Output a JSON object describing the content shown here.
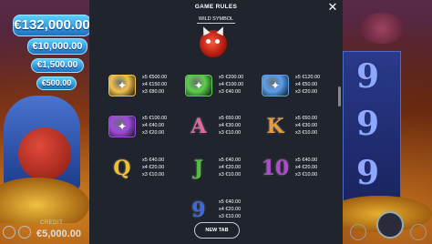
{
  "game": {
    "jackpots": [
      "€132,000.00",
      "€10,000.00",
      "€1,500.00",
      "€500.00"
    ],
    "credit_label": "CREDIT",
    "credit_value": "€5,000.00"
  },
  "reel_symbols": [
    "9",
    "9",
    "9"
  ],
  "panel": {
    "title": "GAME RULES",
    "close": "✕",
    "section": "WILD SYMBOL",
    "button": "NEW TAB"
  },
  "symbols": [
    {
      "icon": "gold-gem-icon",
      "color": "#f4c04a",
      "pays": [
        "x5  €500.00",
        "x4  €150.00",
        "x3  €80.00"
      ]
    },
    {
      "icon": "green-gem-icon",
      "color": "#5ad04a",
      "pays": [
        "x5  €200.00",
        "x4  €100.00",
        "x3  €40.00"
      ]
    },
    {
      "icon": "blue-gem-icon",
      "color": "#5aa0f0",
      "pays": [
        "x5  €120.00",
        "x4  €50.00",
        "x3  €20.00"
      ]
    },
    {
      "icon": "purple-gem-icon",
      "color": "#a04ae0",
      "pays": [
        "x5  €100.00",
        "x4  €40.00",
        "x3  €20.00"
      ]
    },
    {
      "letter": "A",
      "color": "#e06aa0",
      "pays": [
        "x5  €60.00",
        "x4  €30.00",
        "x3  €10.00"
      ]
    },
    {
      "letter": "K",
      "color": "#e89a40",
      "pays": [
        "x5  €60.00",
        "x4  €30.00",
        "x3  €10.00"
      ]
    },
    {
      "letter": "Q",
      "color": "#f0c030",
      "pays": [
        "x5  €40.00",
        "x4  €20.00",
        "x3  €10.00"
      ]
    },
    {
      "letter": "J",
      "color": "#50c040",
      "pays": [
        "x5  €40.00",
        "x4  €20.00",
        "x3  €10.00"
      ]
    },
    {
      "letter": "10",
      "color": "#b04ad0",
      "pays": [
        "x5  €40.00",
        "x4  €20.00",
        "x3  €10.00"
      ]
    },
    {
      "letter": "9",
      "color": "#3a6ae0",
      "pays": [
        "x5  €40.00",
        "x4  €20.00",
        "x3  €10.00"
      ]
    }
  ]
}
